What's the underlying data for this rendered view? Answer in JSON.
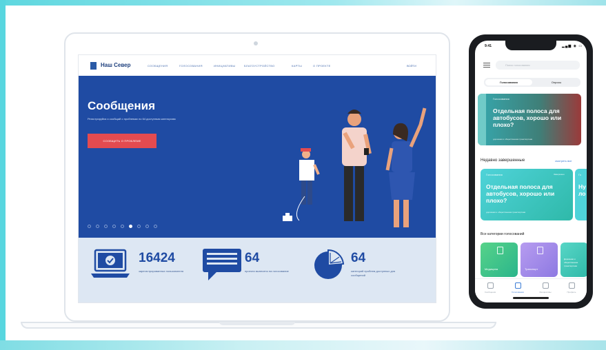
{
  "laptop": {
    "site": {
      "logo_text": "Наш Север",
      "nav": [
        "СООБЩЕНИЯ",
        "ГОЛОСОВАНИЯ",
        "ИНИЦИАТИВЫ",
        "БЛАГОУСТРОЙСТВО",
        "КАРТЫ",
        "О ПРОЕКТЕ"
      ],
      "login": "ВОЙТИ"
    },
    "hero": {
      "title": "Сообщения",
      "subtitle": "Регистрируйся и сообщай о проблемах по 64 доступным категориям",
      "button": "СООБЩИТЬ О ПРОБЛЕМЕ",
      "slide_count": 9,
      "active_slide": 5
    },
    "stats": [
      {
        "value": "16424",
        "text": "зарегистрированных пользователя",
        "icon": "laptop-icon"
      },
      {
        "value": "64",
        "text": "проекта вынесено на голосование",
        "icon": "chat-icon"
      },
      {
        "value": "64",
        "text": "категорий проблем доступных для сообщений",
        "icon": "pie-icon"
      }
    ]
  },
  "phone": {
    "time": "9:41",
    "status_icons": "▂▄▆ ◉ ▭",
    "search_placeholder": "Поиск голосования",
    "segments": [
      "Голосования",
      "Опросы"
    ],
    "featured": {
      "tag": "Голосования",
      "title": "Отдельная полоса для автобусов, хорошо или плохо?",
      "sub": "дорожная и общественная транспортная"
    },
    "recent_title": "Недавно завершенные",
    "see_all": "смотреть все",
    "recent_card": {
      "tag": "Голосования",
      "badge": "Завершено",
      "title": "Отдельная полоса для автобусов, хорошо или плохо?",
      "sub": "дорожная и общественная транспортная"
    },
    "peek_card": {
      "tag": "Го",
      "title": "Ну\nло"
    },
    "categories_title": "Все категории голосований",
    "categories": [
      "Медицина",
      "Транспорт",
      "Дорожная и общественная транспортная"
    ],
    "tabs": [
      "Сообщения",
      "Голосования",
      "Инициативы",
      "Профиль"
    ],
    "active_tab": 1
  },
  "colors": {
    "hero_blue": "#1f4ba3",
    "cta_red": "#e34b50",
    "stats_bg": "#dde7f3",
    "teal": "#4fd3d9"
  }
}
